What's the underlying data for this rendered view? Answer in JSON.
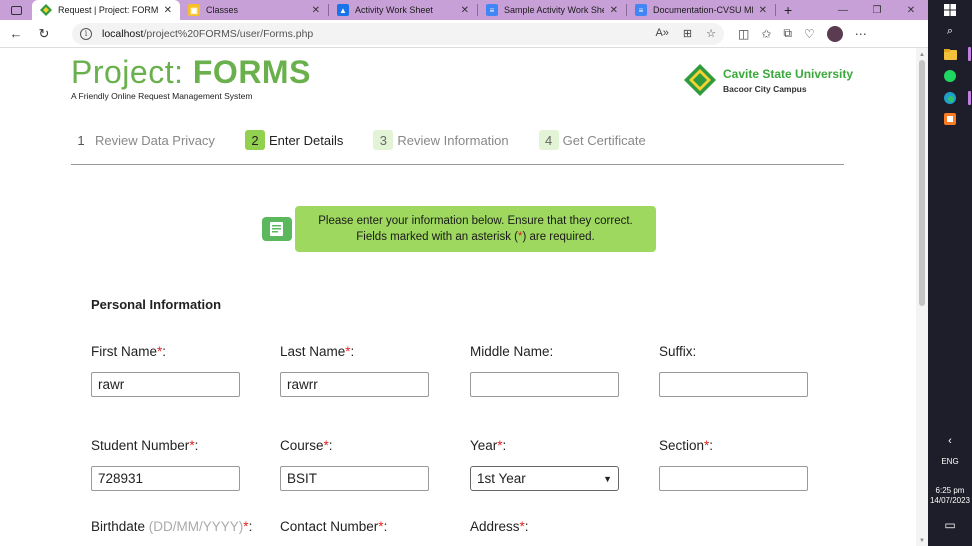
{
  "browser": {
    "tabs": [
      {
        "title": "Request | Project: FORMS",
        "icon": "diamond-logo-icon",
        "active": true,
        "color": "#2e9b3e"
      },
      {
        "title": "Classes",
        "icon": "classroom-icon",
        "active": false,
        "color": "#f6c026"
      },
      {
        "title": "Activity Work Sheet",
        "icon": "classroom-assignment-icon",
        "active": false,
        "color": "#1a73e8"
      },
      {
        "title": "Sample Activity Work Shee",
        "icon": "docs-icon",
        "active": false,
        "color": "#4285f4"
      },
      {
        "title": "Documentation-CVSU MEI",
        "icon": "docs-icon",
        "active": false,
        "color": "#4285f4"
      }
    ],
    "new_tab": "+",
    "url_host": "localhost",
    "url_path": "/project%20FORMS/user/Forms.php"
  },
  "header": {
    "title_light": "Project: ",
    "title_bold": "FORMS",
    "subtitle": "A Friendly Online Request Management System",
    "university": "Cavite State University",
    "campus": "Bacoor City Campus"
  },
  "steps": [
    {
      "num": "1",
      "label": "Review Data Privacy",
      "state": "done"
    },
    {
      "num": "2",
      "label": "Enter Details",
      "state": "active"
    },
    {
      "num": "3",
      "label": "Review Information",
      "state": "todo"
    },
    {
      "num": "4",
      "label": "Get Certificate",
      "state": "todo"
    }
  ],
  "notice": {
    "line1": "Please enter your information below. Ensure that they correct.",
    "line2_a": "Fields marked with an asterisk (",
    "asterisk": "*",
    "line2_b": ") are required."
  },
  "section": {
    "title": "Personal Information"
  },
  "fields": {
    "first_name": {
      "label": "First Name",
      "req": "*",
      "colon": ":",
      "value": "rawr"
    },
    "last_name": {
      "label": "Last Name",
      "req": "*",
      "colon": ":",
      "value": "rawrr"
    },
    "middle_name": {
      "label": "Middle Name:",
      "value": ""
    },
    "suffix": {
      "label": "Suffix:",
      "value": ""
    },
    "student_number": {
      "label": "Student Number",
      "req": "*",
      "colon": ":",
      "value": "728931"
    },
    "course": {
      "label": "Course",
      "req": "*",
      "colon": ":",
      "value": "BSIT"
    },
    "year": {
      "label": "Year",
      "req": "*",
      "colon": ":",
      "value": "1st Year"
    },
    "section": {
      "label": "Section",
      "req": "*",
      "colon": ":",
      "value": ""
    },
    "birthdate": {
      "label": "Birthdate ",
      "hint": "(DD/MM/YYYY)",
      "req": "*",
      "colon": ":"
    },
    "contact": {
      "label": "Contact Number",
      "req": "*",
      "colon": ":"
    },
    "address": {
      "label": "Address",
      "req": "*",
      "colon": ":"
    }
  },
  "system": {
    "lang": "ENG",
    "time": "6:25 pm",
    "date": "14/07/2023"
  },
  "colors": {
    "brand_green": "#6ab04c",
    "notice_green": "#9ed85e",
    "required_red": "#e02020",
    "tab_bar": "#c8a0d8"
  }
}
